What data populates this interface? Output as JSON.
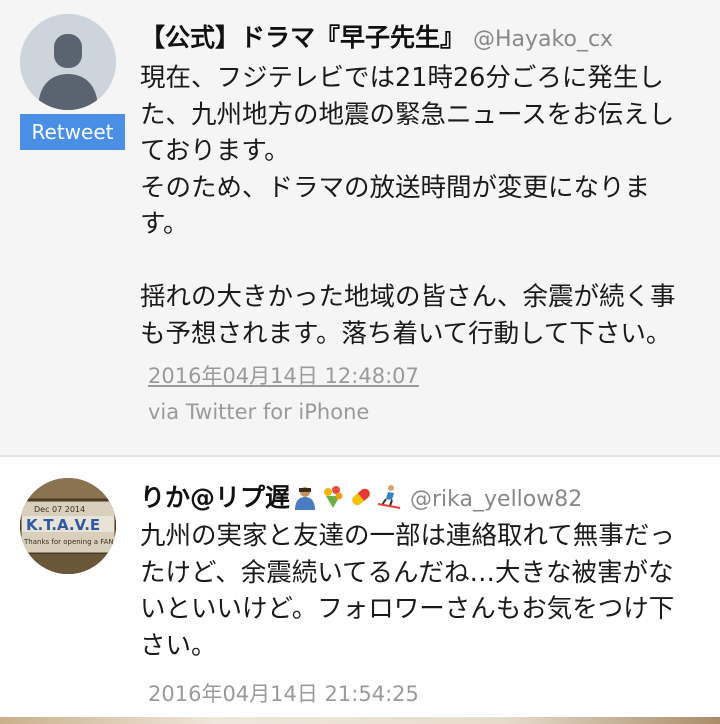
{
  "tweets": [
    {
      "display_name": "【公式】ドラマ『早子先生』",
      "handle": "@Hayako_cx",
      "retweet_badge": "Retweet",
      "text": "現在、フジテレビでは21時26分ごろに発生し\nた、九州地方の地震の緊急ニュースをお伝えし\nております。\nそのため、ドラマの放送時間が変更になりま\nす。\n\n揺れの大きかった地域の皆さん、余震が続く事\nも予想されます。落ち着いて行動して下さい。",
      "timestamp": "2016年04月14日 12:48:07",
      "via": "via Twitter for iPhone",
      "avatar_icon": "default-user-icon"
    },
    {
      "display_name": "りか@リプ遅",
      "handle": "@rika_yellow82",
      "name_emoji": [
        "person-bowing-emoji",
        "bouquet-emoji",
        "pill-emoji",
        "skier-emoji"
      ],
      "text": "九州の実家と友達の一部は連絡取れて無事だっ\nたけど、余震続いてるんだね…大きな被害がな\nいといいけど。フォロワーさんもお気をつけ下\nさい。",
      "timestamp": "2016年04月14日 21:54:25",
      "avatar_text": [
        "Dec 07 2014",
        "K.T.A.V.E",
        "Thanks for opening a FAN"
      ]
    }
  ],
  "colors": {
    "retweet_badge_bg": "#4a8ee6",
    "first_tweet_bg": "#f5f5f5",
    "muted_text": "#9a9a9a"
  }
}
